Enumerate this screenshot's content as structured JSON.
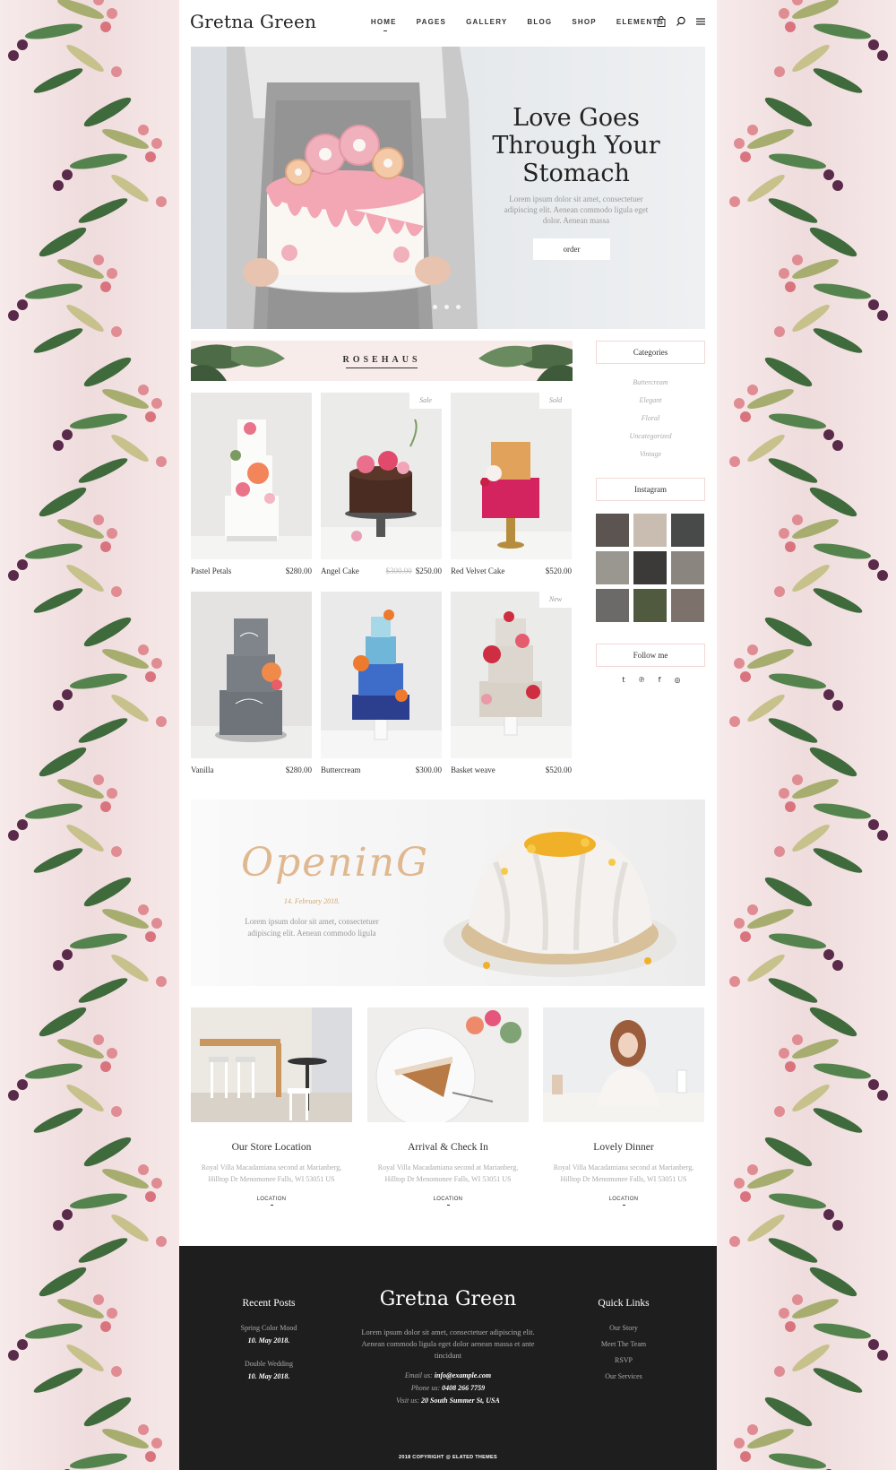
{
  "header": {
    "logo": "Gretna Green",
    "nav": [
      "HOME",
      "PAGES",
      "GALLERY",
      "BLOG",
      "SHOP",
      "ELEMENTS"
    ],
    "icons": [
      "shopping-bag-icon",
      "search-icon",
      "menu-icon"
    ]
  },
  "hero": {
    "title_line1": "Love Goes",
    "title_line2": "Through Your",
    "title_line3": "Stomach",
    "text": "Lorem ipsum dolor sit amet, consectetuer adipiscing elit. Aenean commodo ligula eget dolor. Aenean massa",
    "button": "order"
  },
  "rosehaus": {
    "label": "ROSEHAUS"
  },
  "products": [
    {
      "name": "Pastel Petals",
      "price": "$280.00",
      "old_price": "",
      "tag": ""
    },
    {
      "name": "Angel Cake",
      "price": "$250.00",
      "old_price": "$300.00",
      "tag": "Sale"
    },
    {
      "name": "Red Velvet Cake",
      "price": "$520.00",
      "old_price": "",
      "tag": "Sold"
    },
    {
      "name": "Vanilla",
      "price": "$280.00",
      "old_price": "",
      "tag": ""
    },
    {
      "name": "Buttercream",
      "price": "$300.00",
      "old_price": "",
      "tag": ""
    },
    {
      "name": "Basket weave",
      "price": "$520.00",
      "old_price": "",
      "tag": "New"
    }
  ],
  "sidebar": {
    "categories_title": "Categories",
    "categories": [
      "Buttercream",
      "Elegant",
      "Floral",
      "Uncategorized",
      "Vintage"
    ],
    "instagram_title": "Instagram",
    "follow_title": "Follow me",
    "social_icons": [
      "tumblr-icon",
      "pinterest-icon",
      "facebook-icon",
      "instagram-icon"
    ]
  },
  "opening": {
    "title": "OpeninG",
    "date": "14. February 2018.",
    "text": "Lorem ipsum dolor sit amet, consectetuer adipiscing elit. Aenean commodo ligula"
  },
  "cards": [
    {
      "title": "Our Store Location",
      "text": "Royal Villa Macadamiana second at Marianberg, Hilltop Dr Menomonee Falls, WI 53051 US",
      "link": "LOCATION"
    },
    {
      "title": "Arrival & Check In",
      "text": "Royal Villa Macadamiana second at Marianberg, Hilltop Dr Menomonee Falls, WI 53051 US",
      "link": "LOCATION"
    },
    {
      "title": "Lovely Dinner",
      "text": "Royal Villa Macadamiana second at Marianberg, Hilltop Dr Menomonee Falls, WI 53051 US",
      "link": "LOCATION"
    }
  ],
  "footer": {
    "recent_title": "Recent Posts",
    "posts": [
      {
        "title": "Spring Color Mood",
        "date": "10. May 2018."
      },
      {
        "title": "Double Wedding",
        "date": "10. May 2018."
      }
    ],
    "logo": "Gretna Green",
    "about": "Lorem ipsum dolor sit amet, consectetuer adipiscing elit. Aenean commodo ligula eget dolor aenean massa et ante tincidunt",
    "email_label": "Email us:",
    "email": "info@example.com",
    "phone_label": "Phone us:",
    "phone": "0408 266 7759",
    "visit_label": "Visit us:",
    "visit": "20 South Summer St, USA",
    "links_title": "Quick Links",
    "links": [
      "Our Story",
      "Meet The Team",
      "RSVP",
      "Our Services"
    ],
    "copyright": "2018 COPYRIGHT @ ELATED THEMES"
  },
  "colors": {
    "accent": "#e0b88f",
    "pink_bg": "#f8ecea",
    "footer_bg": "#1e1e1e"
  }
}
